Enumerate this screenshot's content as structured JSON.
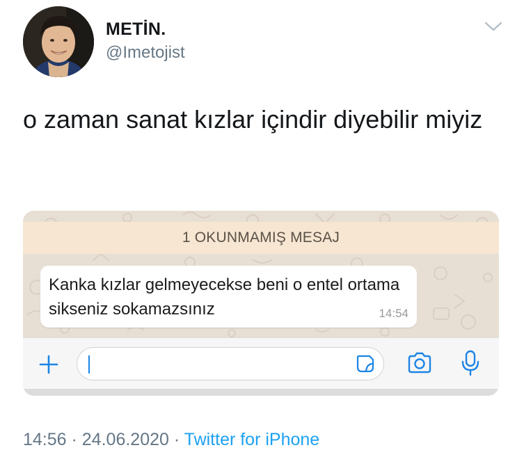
{
  "tweet": {
    "display_name": "METİN.",
    "handle": "@Imetojist",
    "text": "o zaman sanat kızlar içindir diyebilir miyiz",
    "time": "14:56",
    "separator1": " · ",
    "date": "24.06.2020",
    "separator2": " · ",
    "source": "Twitter for iPhone"
  },
  "screenshot": {
    "unread_banner": "1 OKUNMAMIŞ MESAJ",
    "message": {
      "text": "Kanka kızlar gelmeyecekse beni o entel ortama sikseniz sokamazsınız",
      "time": "14:54"
    },
    "input_value": ""
  },
  "icons": {
    "caret": "chevron-down-icon",
    "attach": "plus-icon",
    "sticker": "sticker-icon",
    "camera": "camera-icon",
    "mic": "microphone-icon"
  },
  "colors": {
    "accent": "#1da1f2",
    "whatsapp_blue": "#1b84e5",
    "muted": "#657786",
    "unread_banner_bg": "#f6e6d2",
    "chat_bg": "#e8dfd4"
  }
}
